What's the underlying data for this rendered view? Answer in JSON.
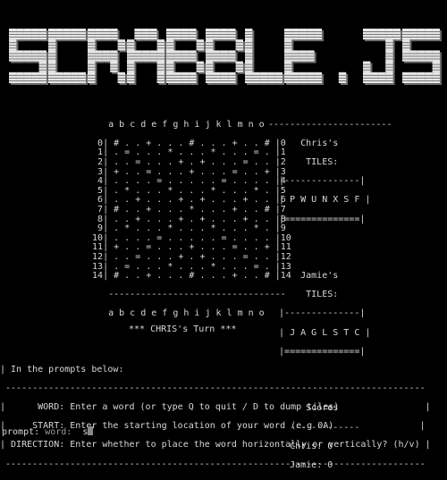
{
  "logo": {
    "text": "SCRABBLE.JS",
    "letters": [
      "S",
      "C",
      "R",
      "A",
      "B",
      "B",
      "L",
      "E",
      ".",
      "J",
      "S"
    ]
  },
  "board": {
    "col_header": "     a b c d e f g h i j k l m n o",
    "rows": [
      "   0| # . . + . . . # . . . + . . # |0",
      "   1| . = . . . * . . . * . . . = . |1",
      "   2| . . = . . . + . + . . . = . . |2",
      "   3| + . . = . . . + . . . = . . + |3",
      "   4| . . . . = . . . . . = . . . . |4",
      "   5| . * . . . * . . . * . . . * . |5",
      "   6| . . + . . . + . + . . . + . . |6",
      "   7| # . . + . . . * . . . + . . # |7",
      "   8| . . + . . . + . + . . . + . . |8",
      "   9| . * . . . * . . . * . . . * . |9",
      "  10| . . . . = . . . . . = . . . . |10",
      "  11| + . . = . . . + . . . = . . + |11",
      "  12| . . = . . . + . + . . . = . . |12",
      "  13| . = . . . * . . . * . . . = . |13",
      "  14| # . . + . . . # . . . + . . # |14"
    ],
    "bottom_rule": "     ---------------------------------",
    "col_footer": "     a b c d e f g h i j k l m n o"
  },
  "sidebar": {
    "top_rule": "-----------------------",
    "player1": {
      "name_line": "      Chris's",
      "tiles_label": "       TILES:",
      "rack_top": "  |--------------|",
      "rack": "  | P W U N X S F |",
      "rack_bottom": "  |==============|"
    },
    "player2": {
      "name_line": "      Jamie's",
      "tiles_label": "       TILES:",
      "rack_top": "  |--------------|",
      "rack": "  | J A G L S T C |",
      "rack_bottom": "  |==============|"
    },
    "scores_title": "       Scores",
    "scores_rule": "    -------------",
    "scores": [
      "    Chris: 0",
      "    Jamie: 0"
    ]
  },
  "turn": "*** CHRIS's Turn ***",
  "instructions": {
    "intro": "| In the prompts below:",
    "rule": " ------------------------------------------------------------------------------",
    "lines": [
      "|      WORD: Enter a word (or type Q to quit / D to dump tiles)                |",
      "|     START: Enter the starting location of your word (e.g 0A)                |",
      "| DIRECTION: Enter whether to place the word horizontally or vertically? (h/v) |"
    ],
    "rule_bottom": " ------------------------------------------------------------------------------"
  },
  "prompt": {
    "label": "prompt:",
    "field": "word:",
    "value": "s"
  }
}
